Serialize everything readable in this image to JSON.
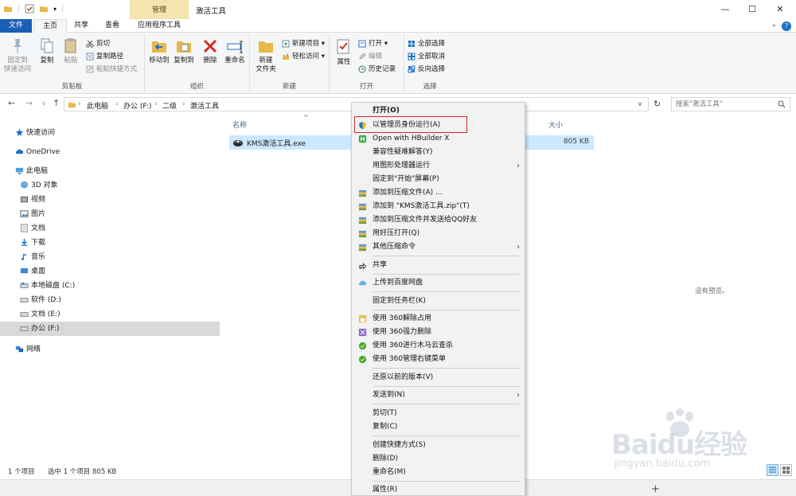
{
  "window": {
    "title": "激活工具",
    "context_tab_header": "管理",
    "minimize": "—",
    "maximize": "☐",
    "close": "✕"
  },
  "ribbon_tabs": [
    "文件",
    "主页",
    "共享",
    "查看",
    "应用程序工具"
  ],
  "ribbon": {
    "clipboard": {
      "label": "剪贴板",
      "pin": "固定到\n快速访问",
      "copy": "复制",
      "paste": "粘贴",
      "cut": "剪切",
      "copy_path": "复制路径",
      "paste_shortcut": "粘贴快捷方式"
    },
    "organize": {
      "label": "组织",
      "move_to": "移动到",
      "copy_to": "复制到",
      "delete": "删除",
      "rename": "重命名"
    },
    "new": {
      "label": "新建",
      "new_folder": "新建\n文件夹",
      "new_item": "新建项目",
      "easy_access": "轻松访问"
    },
    "open": {
      "label": "打开",
      "properties": "属性",
      "open": "打开",
      "edit": "编辑",
      "history": "历史记录"
    },
    "select": {
      "label": "选择",
      "select_all": "全部选择",
      "select_none": "全部取消",
      "invert": "反向选择"
    }
  },
  "address": {
    "crumbs": [
      "此电脑",
      "办公 (F:)",
      "二级",
      "激活工具"
    ],
    "search_placeholder": "搜索\"激活工具\""
  },
  "sidebar": {
    "items": [
      {
        "label": "快速访问",
        "icon": "star-icon"
      },
      {
        "label": "OneDrive",
        "icon": "cloud-icon"
      },
      {
        "label": "此电脑",
        "icon": "computer-icon"
      },
      {
        "label": "3D 对象",
        "icon": "cube-icon"
      },
      {
        "label": "视频",
        "icon": "video-icon"
      },
      {
        "label": "图片",
        "icon": "picture-icon"
      },
      {
        "label": "文档",
        "icon": "document-icon"
      },
      {
        "label": "下载",
        "icon": "download-icon"
      },
      {
        "label": "音乐",
        "icon": "music-icon"
      },
      {
        "label": "桌面",
        "icon": "desktop-icon"
      },
      {
        "label": "本地磁盘 (C:)",
        "icon": "drive-icon"
      },
      {
        "label": "软件 (D:)",
        "icon": "drive-icon"
      },
      {
        "label": "文档 (E:)",
        "icon": "drive-icon"
      },
      {
        "label": "办公 (F:)",
        "icon": "drive-icon"
      },
      {
        "label": "网络",
        "icon": "network-icon"
      }
    ]
  },
  "filelist": {
    "col_name": "名称",
    "col_size": "大小",
    "files": [
      {
        "name": "KMS激活工具.exe",
        "size": "805 KB"
      }
    ],
    "preview_text": "没有预览。"
  },
  "context_menu": {
    "items": [
      {
        "label": "打开(O)"
      },
      {
        "label": "以管理员身份运行(A)"
      },
      {
        "label": "Open with HBuilder X"
      },
      {
        "label": "兼容性疑难解答(Y)"
      },
      {
        "label": "用图形处理器运行"
      },
      {
        "label": "固定到\"开始\"屏幕(P)"
      },
      {
        "label": "添加到压缩文件(A) ..."
      },
      {
        "label": "添加到 \"KMS激活工具.zip\"(T)"
      },
      {
        "label": "添加到压缩文件并发送给QQ好友"
      },
      {
        "label": "用好压打开(Q)"
      },
      {
        "label": "其他压缩命令"
      },
      {
        "label": "共享"
      },
      {
        "label": "上传到百度网盘"
      },
      {
        "label": "固定到任务栏(K)"
      },
      {
        "label": "使用 360解除占用"
      },
      {
        "label": "使用 360强力删除"
      },
      {
        "label": "使用 360进行木马云查杀"
      },
      {
        "label": "使用 360管理右键菜单"
      },
      {
        "label": "还原以前的版本(V)"
      },
      {
        "label": "发送到(N)"
      },
      {
        "label": "剪切(T)"
      },
      {
        "label": "复制(C)"
      },
      {
        "label": "创建快捷方式(S)"
      },
      {
        "label": "删除(D)"
      },
      {
        "label": "重命名(M)"
      },
      {
        "label": "属性(R)"
      }
    ]
  },
  "status": {
    "count": "1 个项目",
    "selected": "选中 1 个项目  805 KB"
  },
  "watermark": {
    "text": "Baidu经验",
    "url": "jingyan.baidu.com"
  },
  "colors": {
    "accent": "#1a5fb4",
    "selection": "#cce8ff",
    "context_tab": "#f3e5ad",
    "highlight_box": "#c8302c"
  }
}
